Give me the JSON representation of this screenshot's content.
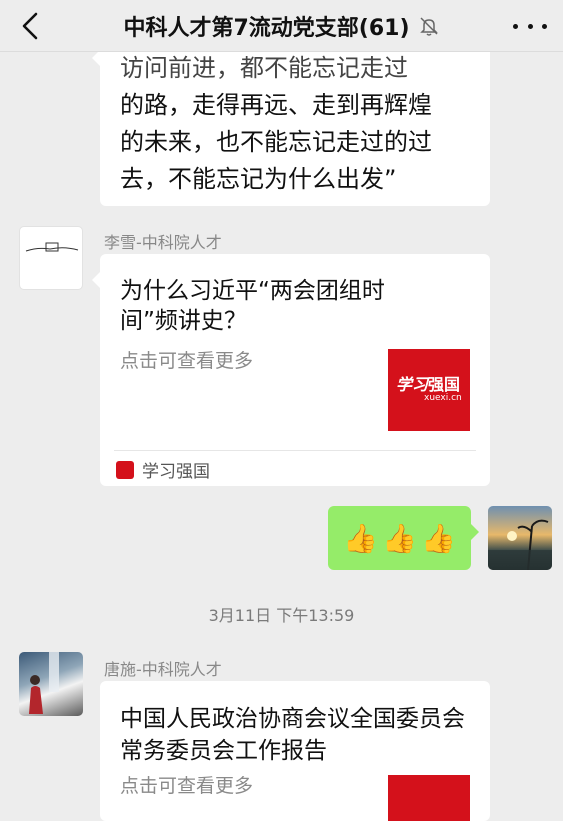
{
  "header": {
    "title": "中科人才第7流动党支部(61)",
    "back_icon": "chevron-left-icon",
    "mute_icon": "bell-muted-icon",
    "more_icon": "more-dots-icon"
  },
  "messages": {
    "m1": {
      "lines": [
        "访问前进，都不能忘记走过",
        "的路，走得再远、走到再辉煌",
        "的未来，也不能忘记走过的过",
        "去，不能忘记为什么出发”"
      ]
    },
    "m2": {
      "sender": "李雪-中科院人才",
      "card_title": "为什么习近平“两会团组时间”频讲史？",
      "card_desc": "点击可查看更多",
      "source": "学习强国",
      "thumb_text": "强国",
      "thumb_sub": "xuexi.cn"
    },
    "m3": {
      "emoji": [
        "👍",
        "👍",
        "👍"
      ]
    },
    "timestamp": "3月11日 下午13:59",
    "m4": {
      "sender": "唐施-中科院人才",
      "card_title": "中国人民政治协商会议全国委员会常务委员会工作报告",
      "card_desc": "点击可查看更多"
    }
  },
  "colors": {
    "background": "#ededed",
    "bubble_self": "#95ec69",
    "xuexi_red": "#d4111b"
  }
}
